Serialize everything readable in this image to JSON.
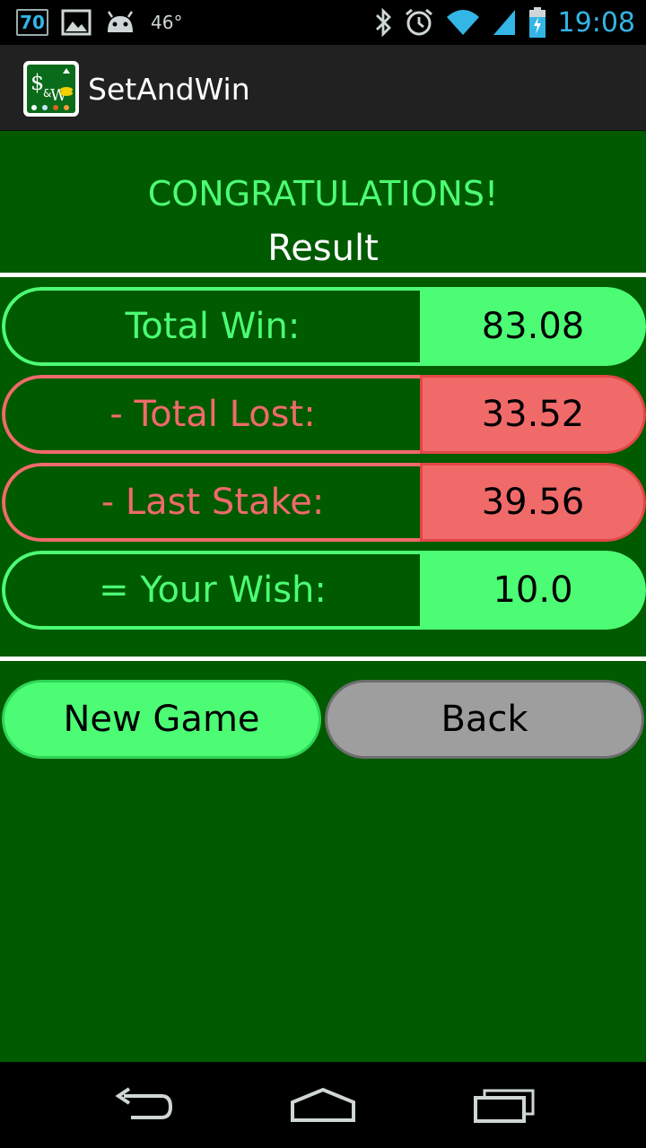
{
  "status_bar": {
    "badge": "70",
    "temperature": "46°",
    "time": "19:08",
    "icons": [
      "image-icon",
      "android-icon",
      "bluetooth-icon",
      "alarm-icon",
      "wifi-icon",
      "signal-icon",
      "battery-icon"
    ]
  },
  "action_bar": {
    "title": "SetAndWin"
  },
  "main": {
    "congrats": "CONGRATULATIONS!",
    "result_title": "Result",
    "rows": [
      {
        "label": "Total Win:",
        "value": "83.08",
        "color": "green"
      },
      {
        "label": "- Total Lost:",
        "value": "33.52",
        "color": "red"
      },
      {
        "label": "- Last Stake:",
        "value": "39.56",
        "color": "red"
      },
      {
        "label": "= Your Wish:",
        "value": "10.0",
        "color": "green"
      }
    ]
  },
  "buttons": {
    "new_game": "New Game",
    "back": "Back"
  },
  "colors": {
    "background": "#005a00",
    "accent_green": "#4cfc74",
    "accent_red": "#f06a6a",
    "button_gray": "#9e9e9e",
    "status_blue": "#33b5e5"
  },
  "nav_bar": {
    "icons": [
      "back-icon",
      "home-icon",
      "recent-apps-icon"
    ]
  }
}
